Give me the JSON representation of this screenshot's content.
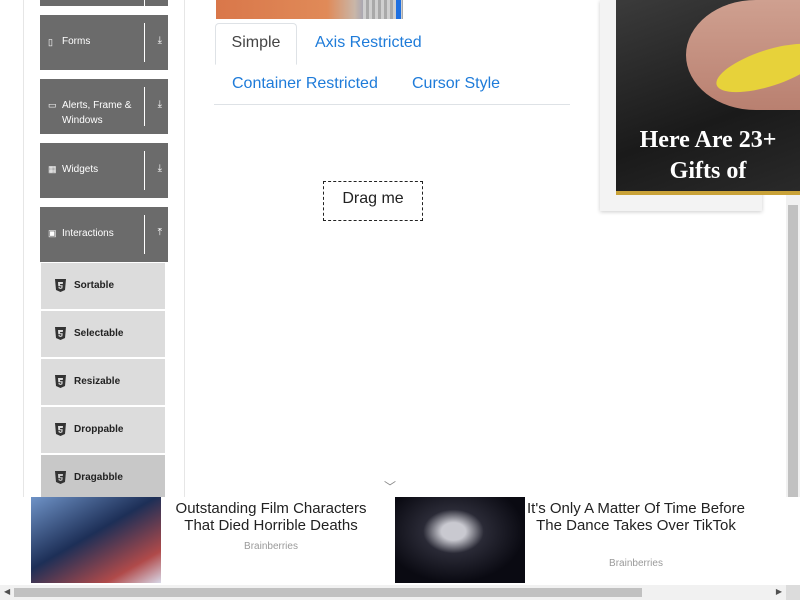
{
  "sidebar": {
    "groups": [
      {
        "label": "Forms",
        "icon": "form-icon",
        "expanded": false
      },
      {
        "label": "Alerts, Frame & Windows",
        "icon": "window-icon",
        "expanded": false
      },
      {
        "label": "Widgets",
        "icon": "grid-icon",
        "expanded": false
      },
      {
        "label": "Interactions",
        "icon": "collapse-icon",
        "expanded": true
      }
    ],
    "items": [
      {
        "label": "Sortable"
      },
      {
        "label": "Selectable"
      },
      {
        "label": "Resizable"
      },
      {
        "label": "Droppable"
      },
      {
        "label": "Dragabble",
        "active": true
      }
    ]
  },
  "tabs": [
    {
      "label": "Simple",
      "active": true
    },
    {
      "label": "Axis Restricted"
    },
    {
      "label": "Container Restricted"
    },
    {
      "label": "Cursor Style"
    }
  ],
  "drag_box": {
    "label": "Drag me"
  },
  "side_ad": {
    "headline_line1": "Here Are 23+",
    "headline_line2": "Gifts of"
  },
  "bottom_ads": [
    {
      "title": "Outstanding Film Characters That Died Horrible Deaths",
      "source": "Brainberries"
    },
    {
      "title": "It's Only A Matter Of Time Before The Dance Takes Over TikTok",
      "source": "Brainberries"
    }
  ],
  "colors": {
    "link": "#1e7bd9",
    "sidebar_group": "#6b6b6b",
    "sidebar_item": "#dcdcdc"
  }
}
